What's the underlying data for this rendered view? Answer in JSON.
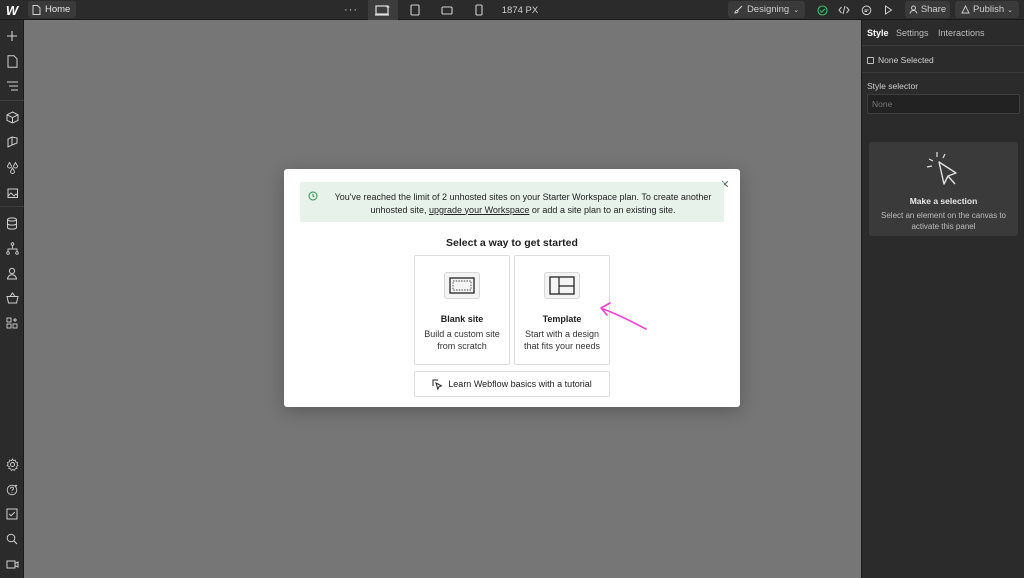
{
  "topbar": {
    "home_label": "Home",
    "more_label": "···",
    "width_readout": "1874 PX",
    "mode_label": "Designing",
    "share_label": "Share",
    "publish_label": "Publish"
  },
  "right_panel": {
    "tabs": [
      {
        "label": "Style"
      },
      {
        "label": "Settings"
      },
      {
        "label": "Interactions"
      }
    ],
    "none_selected": "None Selected",
    "style_selector_label": "Style selector",
    "style_selector_placeholder": "None",
    "selection_card": {
      "title": "Make a selection",
      "description": "Select an element on the canvas to activate this panel"
    }
  },
  "modal": {
    "banner": {
      "text_before": "You've reached the limit of 2 unhosted sites on your Starter Workspace plan. To create another unhosted site, ",
      "link_text": "upgrade your Workspace",
      "text_after": " or add a site plan to an existing site."
    },
    "heading": "Select a way to get started",
    "options": [
      {
        "title": "Blank site",
        "description": "Build a custom site from scratch"
      },
      {
        "title": "Template",
        "description": "Start with a design that fits your needs"
      }
    ],
    "tutorial_label": "Learn Webflow basics with a tutorial"
  },
  "colors": {
    "canvas": "#767676",
    "panel": "#2b2b2b",
    "banner_bg": "#e7f2ea",
    "banner_icon": "#2f8f4e",
    "annotation_arrow": "#f03fd4",
    "check_ok": "#3fbf6a"
  },
  "icons": {
    "logo": "webflow-logo",
    "page": "page-icon",
    "add": "plus-icon",
    "close": "close-icon"
  }
}
